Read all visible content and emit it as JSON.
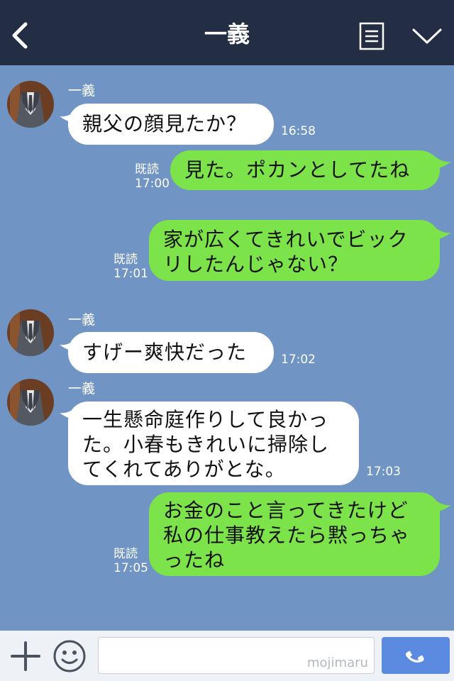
{
  "header": {
    "title": "一義",
    "back_icon": "back-chevron-icon",
    "notes_icon": "notes-icon",
    "collapse_icon": "chevron-down-icon"
  },
  "colors": {
    "header_bg": "#232e45",
    "chat_bg": "#7094c4",
    "incoming_bubble": "#ffffff",
    "outgoing_bubble": "#7de34a",
    "call_button": "#5a8be0"
  },
  "messages": [
    {
      "direction": "in",
      "sender": "一義",
      "lines": [
        "親父の顔見たか？"
      ],
      "time": "16:58"
    },
    {
      "direction": "out",
      "read": "既読",
      "lines": [
        "見た。ポカンとしてたね"
      ],
      "time": "17:00"
    },
    {
      "direction": "out",
      "read": "既読",
      "lines": [
        "家が広くてきれいでビック",
        "リしたんじゃない？"
      ],
      "time": "17:01"
    },
    {
      "direction": "in",
      "sender": "一義",
      "lines": [
        "すげー爽快だった"
      ],
      "time": "17:02"
    },
    {
      "direction": "in",
      "sender": "一義",
      "lines": [
        "一生懸命庭作りして良かっ",
        "た。小春もきれいに掃除し",
        "てくれてありがとな。"
      ],
      "time": "17:03"
    },
    {
      "direction": "out",
      "read": "既読",
      "lines": [
        "お金のこと言ってきたけど",
        "私の仕事教えたら黙っちゃ",
        "ったね"
      ],
      "time": "17:05"
    }
  ],
  "input_bar": {
    "add_icon": "plus-icon",
    "emoji_icon": "emoji-icon",
    "input_value": "",
    "watermark": "mojimaru",
    "call_icon": "phone-icon"
  }
}
